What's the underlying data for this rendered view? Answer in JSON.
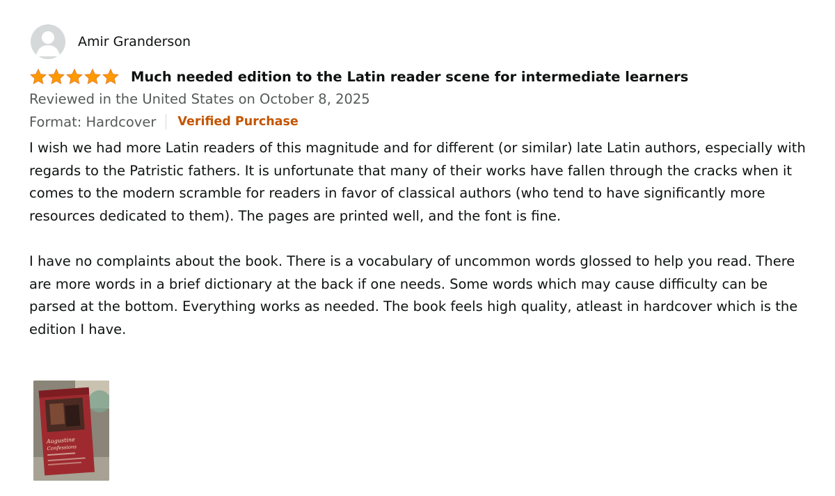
{
  "reviewer": {
    "name": "Amir Granderson",
    "avatar_icon": "default-profile-avatar-icon"
  },
  "review": {
    "rating": 5,
    "rating_max": 5,
    "star_color": "#ff9900",
    "title": "Much needed edition to the Latin reader scene for intermediate learners",
    "date": "Reviewed in the United States on October 8, 2025",
    "format": "Format: Hardcover",
    "verified": "Verified Purchase",
    "verified_color": "#c45500",
    "body": [
      "I wish we had more Latin readers of this magnitude and for different (or similar) late Latin authors, especially with regards to the Patristic fathers. It is unfortunate that many of their works have fallen through the cracks when it comes to the modern scramble for readers in favor of classical authors (who tend to have significantly more resources dedicated to them). The pages are printed well, and the font is fine.",
      "I have no complaints about the book. There is a vocabulary of uncommon words glossed to help you read. There are more words in a brief dictionary at the back if one needs. Some words which may cause difficulty can be parsed at the bottom. Everything works as needed. The book feels high quality, atleast in hardcover which is the edition I have."
    ]
  },
  "image": {
    "cover_title": "Augustine",
    "cover_subtitle": "Confessions"
  }
}
